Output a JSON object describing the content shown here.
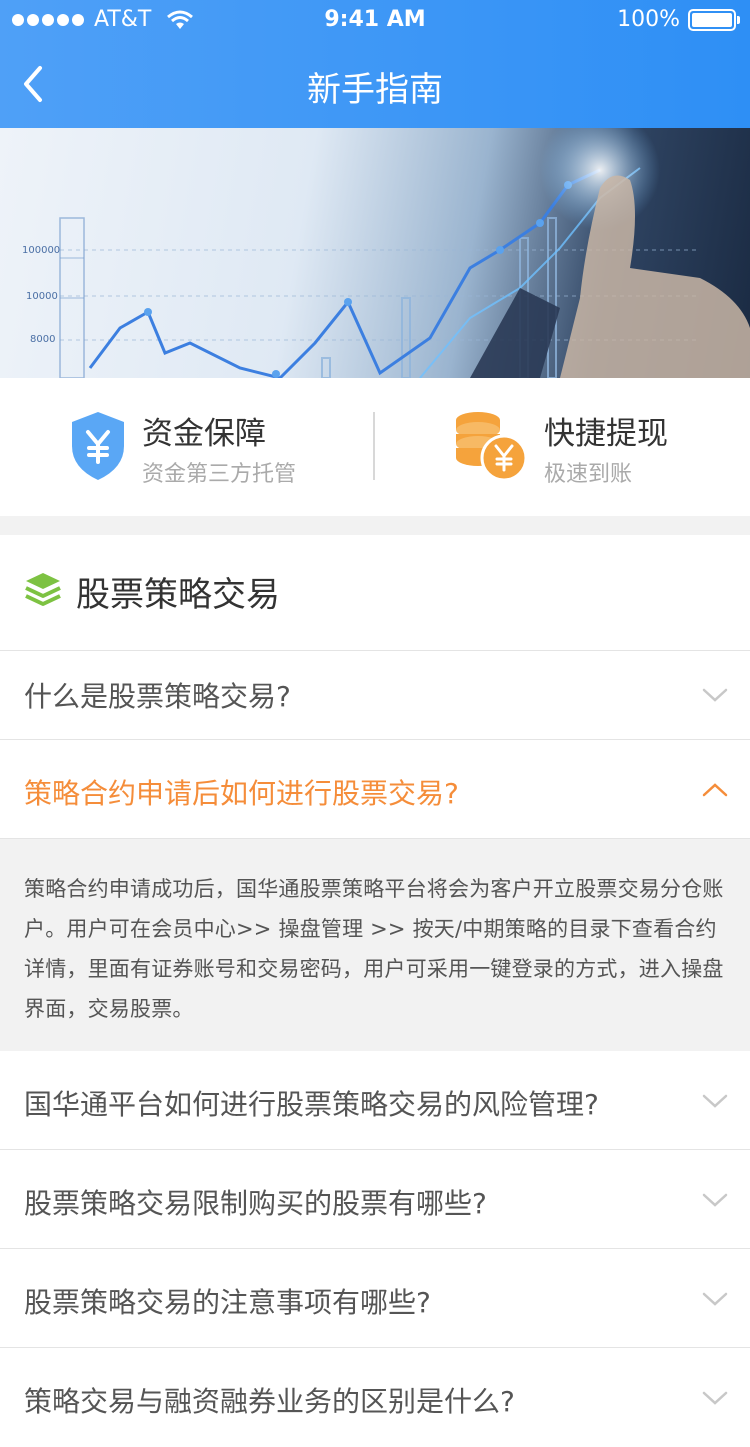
{
  "status_bar": {
    "carrier": "AT&T",
    "time": "9:41 AM",
    "battery": "100%"
  },
  "nav": {
    "title": "新手指南"
  },
  "banner": {
    "tick_labels": [
      "100000",
      "10000",
      "8000"
    ]
  },
  "features": [
    {
      "title": "资金保障",
      "subtitle": "资金第三方托管",
      "icon": "shield-yen-icon",
      "color": "#5aa7f5"
    },
    {
      "title": "快捷提现",
      "subtitle": "极速到账",
      "icon": "coins-yen-icon",
      "color": "#f5a33c"
    }
  ],
  "section": {
    "title": "股票策略交易",
    "icon": "layers-icon",
    "icon_color": "#7dc242"
  },
  "faq": {
    "items": [
      {
        "question": "什么是股票策略交易?",
        "expanded": false
      },
      {
        "question": "策略合约申请后如何进行股票交易?",
        "expanded": true,
        "answer": "策略合约申请成功后，国华通股票策略平台将会为客户开立股票交易分仓账户。用户可在会员中心>> 操盘管理 >> 按天/中期策略的目录下查看合约详情，里面有证券账号和交易密码，用户可采用一键登录的方式，进入操盘界面，交易股票。"
      },
      {
        "question": "国华通平台如何进行股票策略交易的风险管理?",
        "expanded": false
      },
      {
        "question": "股票策略交易限制购买的股票有哪些?",
        "expanded": false
      },
      {
        "question": "股票策略交易的注意事项有哪些?",
        "expanded": false
      },
      {
        "question": "策略交易与融资融券业务的区别是什么?",
        "expanded": false
      }
    ]
  },
  "colors": {
    "brand_blue": "#2e8ff5",
    "accent_orange": "#f58d3a"
  }
}
